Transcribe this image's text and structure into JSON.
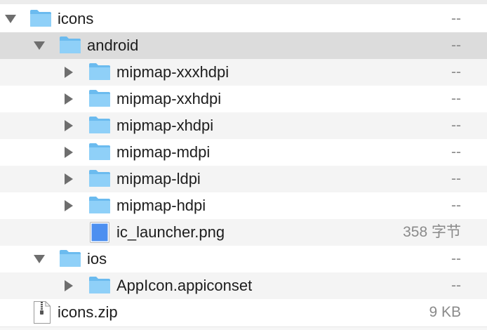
{
  "rows": [
    {
      "name": "icons",
      "size": "--",
      "kind": "folder",
      "disclosure": "expanded"
    },
    {
      "name": "android",
      "size": "--",
      "kind": "folder",
      "disclosure": "expanded",
      "selected": true
    },
    {
      "name": "mipmap-xxxhdpi",
      "size": "--",
      "kind": "folder",
      "disclosure": "collapsed"
    },
    {
      "name": "mipmap-xxhdpi",
      "size": "--",
      "kind": "folder",
      "disclosure": "collapsed"
    },
    {
      "name": "mipmap-xhdpi",
      "size": "--",
      "kind": "folder",
      "disclosure": "collapsed"
    },
    {
      "name": "mipmap-mdpi",
      "size": "--",
      "kind": "folder",
      "disclosure": "collapsed"
    },
    {
      "name": "mipmap-ldpi",
      "size": "--",
      "kind": "folder",
      "disclosure": "collapsed"
    },
    {
      "name": "mipmap-hdpi",
      "size": "--",
      "kind": "folder",
      "disclosure": "collapsed"
    },
    {
      "name": "ic_launcher.png",
      "size": "358 字节",
      "kind": "png-file",
      "disclosure": "none"
    },
    {
      "name": "ios",
      "size": "--",
      "kind": "folder",
      "disclosure": "expanded"
    },
    {
      "name": "AppIcon.appiconset",
      "size": "--",
      "kind": "folder",
      "disclosure": "collapsed"
    },
    {
      "name": "icons.zip",
      "size": "9 KB",
      "kind": "zip-file",
      "disclosure": "none"
    }
  ],
  "colors": {
    "folder_fill": "#8fd0f8",
    "folder_tab": "#6bbbef",
    "png_fill": "#4c8ff0",
    "disclosure": "#6e6e6e",
    "selected_row": "#dcdcdc",
    "stripe_row": "#f4f4f4"
  }
}
